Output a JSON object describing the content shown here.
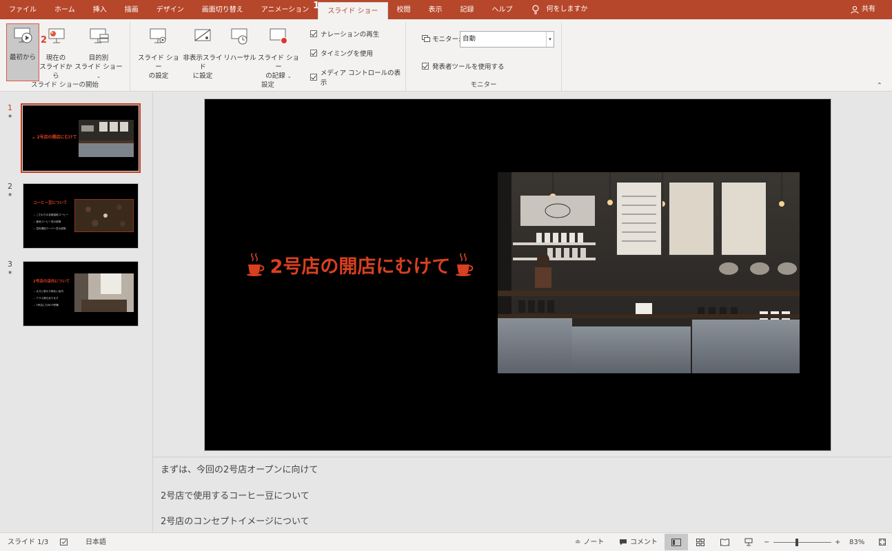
{
  "tabs": [
    "ファイル",
    "ホーム",
    "挿入",
    "描画",
    "デザイン",
    "画面切り替え",
    "アニメーション",
    "スライド ショー",
    "校閲",
    "表示",
    "記録",
    "ヘルプ"
  ],
  "active_tab": "スライド ショー",
  "step_markers": {
    "one": "1",
    "two": "2"
  },
  "tell_me": "何をしますか",
  "share": "共有",
  "ribbon": {
    "start_group": {
      "label": "スライド ショーの開始",
      "from_beginning": "最初から",
      "from_current_1": "現在の",
      "from_current_2": "スライドから",
      "custom_1": "目的別",
      "custom_2": "スライド ショー"
    },
    "setup_group": {
      "label": "設定",
      "setup_1": "スライド ショー",
      "setup_2": "の設定",
      "hide_1": "非表示スライド",
      "hide_2": "に設定",
      "rehearse": "リハーサル",
      "record_1": "スライド ショー",
      "record_2": "の記録",
      "play_narration": "ナレーションの再生",
      "use_timings": "タイミングを使用",
      "show_media": "メディア コントロールの表示"
    },
    "monitor_group": {
      "label": "モニター",
      "monitor_label": "モニター:",
      "monitor_value": "自動",
      "presenter_view": "発表者ツールを使用する"
    }
  },
  "thumbnails": [
    {
      "num": "1",
      "title": "2号店の開店にむけて"
    },
    {
      "num": "2",
      "title": "コーヒー豆について",
      "bullets": [
        "こだわりの自家焙煎コーヒー",
        "産地コーヒー豆の説明",
        "豆料理用ワーバー豆の説明"
      ]
    },
    {
      "num": "3",
      "title": "2号店の店内について",
      "bullets": [
        "大きい窓から明るい店内",
        "テラス席もあります",
        "2号店にもWi-Fi完備"
      ]
    }
  ],
  "slide": {
    "title": "2号店の開店にむけて"
  },
  "notes": [
    "まずは、今回の2号店オープンに向けて",
    "2号店で使用するコーヒー豆について",
    "2号店のコンセプトイメージについて"
  ],
  "status": {
    "slide_counter": "スライド 1/3",
    "language": "日本語",
    "notes_btn": "ノート",
    "comments_btn": "コメント",
    "zoom": "83%"
  },
  "colors": {
    "accent": "#b7472a",
    "title_red": "#d9401f"
  }
}
